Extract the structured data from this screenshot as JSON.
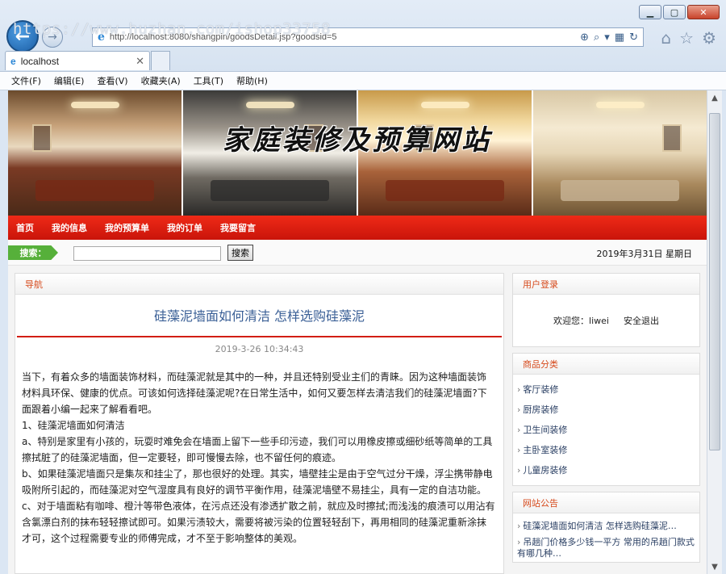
{
  "browser": {
    "watermark": "https://www.huzhan.com/ishop33758",
    "url": "http://localhost:8080/shangpin/goodsDetail.jsp?goodsid=5",
    "tab_label": "localhost",
    "menu": [
      "文件(F)",
      "编辑(E)",
      "查看(V)",
      "收藏夹(A)",
      "工具(T)",
      "帮助(H)"
    ]
  },
  "site": {
    "title": "家庭装修及预算网站",
    "nav": [
      "首页",
      "我的信息",
      "我的预算单",
      "我的订单",
      "我要留言"
    ],
    "search": {
      "label": "搜索：",
      "placeholder": "",
      "button": "搜索"
    },
    "date": "2019年3月31日  星期日"
  },
  "main": {
    "section_label": "导航",
    "article": {
      "title": "硅藻泥墙面如何清洁 怎样选购硅藻泥",
      "date": "2019-3-26 10:34:43",
      "paragraphs": [
        "当下，有着众多的墙面装饰材料，而硅藻泥就是其中的一种，并且还特别受业主们的青睐。因为这种墙面装饰材料具环保、健康的优点。可该如何选择硅藻泥呢?在日常生活中，如何又要怎样去清洁我们的硅藻泥墙面?下面跟着小编一起来了解看看吧。",
        "1、硅藻泥墙面如何清洁",
        "a、特别是家里有小孩的，玩耍时难免会在墙面上留下一些手印污迹，我们可以用橡皮擦或细砂纸等简单的工具擦拭脏了的硅藻泥墙面，但一定要轻，即可慢慢去除，也不留任何的痕迹。",
        "b、如果硅藻泥墙面只是集灰和挂尘了，那也很好的处理。其实，墙壁挂尘是由于空气过分干燥，浮尘携带静电吸附所引起的，而硅藻泥对空气湿度具有良好的调节平衡作用，硅藻泥墙壁不易挂尘，具有一定的自洁功能。",
        "c、对于墙面粘有咖啡、橙汁等带色液体，在污点还没有渗透扩散之前，就应及时擦拭;而浅浅的痕渍可以用沾有含氯漂白剂的抹布轻轻擦试即可。如果污渍较大，需要将被污染的位置轻轻刮下，再用相同的硅藻泥重新涂抹才可，这个过程需要专业的师傅完成，才不至于影响整体的美观。"
      ]
    }
  },
  "sidebar": {
    "login": {
      "title": "用户登录",
      "welcome": "欢迎您：liwei",
      "logout": "安全退出"
    },
    "categories": {
      "title": "商品分类",
      "items": [
        "客厅装修",
        "厨房装修",
        "卫生间装修",
        "主卧室装修",
        "儿童房装修"
      ]
    },
    "news": {
      "title": "网站公告",
      "items": [
        "硅藻泥墙面如何清洁 怎样选购硅藻泥…",
        "吊趟门价格多少钱一平方 常用的吊趟门款式有哪几种…"
      ]
    }
  }
}
